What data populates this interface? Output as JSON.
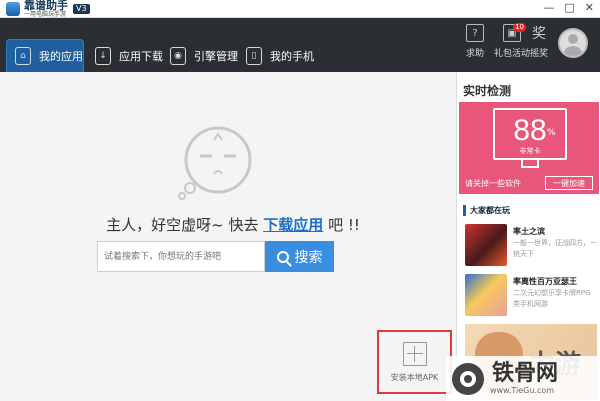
{
  "app": {
    "name": "靠谱助手",
    "subtitle": "一用电脑玩手游",
    "version": "V3"
  },
  "window_controls": {
    "minimize": "—",
    "maximize": "□",
    "close": "✕"
  },
  "nav": {
    "tabs": [
      {
        "label": "我的应用",
        "icon": "home-icon",
        "active": true
      },
      {
        "label": "应用下载",
        "icon": "download-icon"
      },
      {
        "label": "引擎管理",
        "icon": "android-icon"
      },
      {
        "label": "我的手机",
        "icon": "phone-icon"
      }
    ],
    "actions": [
      {
        "label": "求助",
        "icon": "help-icon"
      },
      {
        "label": "礼包活动",
        "icon": "gift-icon",
        "badge": "10"
      },
      {
        "label": "摇奖",
        "icon": "lottery-icon"
      }
    ]
  },
  "main": {
    "empty_prefix": "主人，好空虚呀~ 快去",
    "empty_link": "下载应用",
    "empty_suffix": "吧 !!",
    "search_placeholder": "试着搜索下，你想玩的手游吧",
    "search_button": "搜索",
    "apk_button": "安装本地APK"
  },
  "sidebar": {
    "realtime_title": "实时检测",
    "realtime_value": "88",
    "realtime_unit": "%",
    "realtime_status": "非常卡",
    "realtime_hint": "请关掉一些软件",
    "boost_button": "一键加速",
    "games_title": "大家都在玩",
    "games": [
      {
        "name": "率土之滨",
        "desc": "一般一世界，征战四方，一统天下"
      },
      {
        "name": "率离性百万亚瑟王",
        "desc": "二次元幻想乐享卡牌RPG类手机网游"
      }
    ],
    "banner_text": "力游"
  },
  "watermark": {
    "text": "铁骨网",
    "url": "www.TieGu.com"
  },
  "colors": {
    "nav_bg": "#2b2f33",
    "active_tab": "#1f5fa0",
    "accent_blue": "#3b8de0",
    "realtime_bg": "#e8577a",
    "link": "#1a6fc8",
    "apk_border": "#e03a3a"
  }
}
